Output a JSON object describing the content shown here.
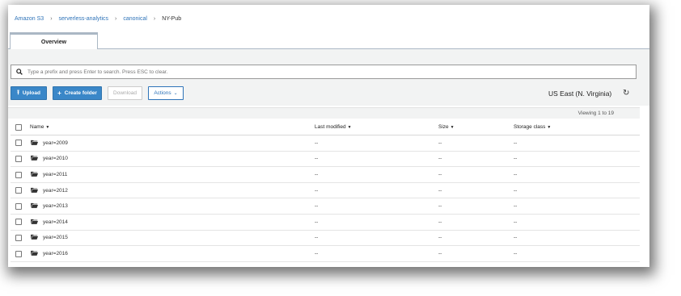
{
  "breadcrumb": {
    "items": [
      "Amazon S3",
      "serverless-analytics",
      "canonical"
    ],
    "current": "NY-Pub"
  },
  "tabs": [
    {
      "label": "Overview"
    }
  ],
  "search": {
    "placeholder": "Type a prefix and press Enter to search. Press ESC to clear."
  },
  "toolbar": {
    "upload_label": "Upload",
    "create_folder_label": "Create folder",
    "download_label": "Download",
    "actions_label": "Actions"
  },
  "region": "US East (N. Virginia)",
  "viewing_text": "Viewing 1 to 19",
  "table": {
    "columns": [
      "Name",
      "Last modified",
      "Size",
      "Storage class"
    ],
    "rows": [
      {
        "name": "year=2009",
        "last_modified": "--",
        "size": "--",
        "storage_class": "--"
      },
      {
        "name": "year=2010",
        "last_modified": "--",
        "size": "--",
        "storage_class": "--"
      },
      {
        "name": "year=2011",
        "last_modified": "--",
        "size": "--",
        "storage_class": "--"
      },
      {
        "name": "year=2012",
        "last_modified": "--",
        "size": "--",
        "storage_class": "--"
      },
      {
        "name": "year=2013",
        "last_modified": "--",
        "size": "--",
        "storage_class": "--"
      },
      {
        "name": "year=2014",
        "last_modified": "--",
        "size": "--",
        "storage_class": "--"
      },
      {
        "name": "year=2015",
        "last_modified": "--",
        "size": "--",
        "storage_class": "--"
      },
      {
        "name": "year=2016",
        "last_modified": "--",
        "size": "--",
        "storage_class": "--"
      }
    ]
  },
  "icons": {
    "search": "search-icon",
    "upload": "upload-icon",
    "create_folder": "plus-icon",
    "actions_dropdown": "chevron-down-icon",
    "refresh": "refresh-icon",
    "folder": "folder-icon"
  },
  "colors": {
    "accent": "#3a87c8",
    "link": "#2e73b8",
    "panel_bg": "#f2f3f3"
  }
}
